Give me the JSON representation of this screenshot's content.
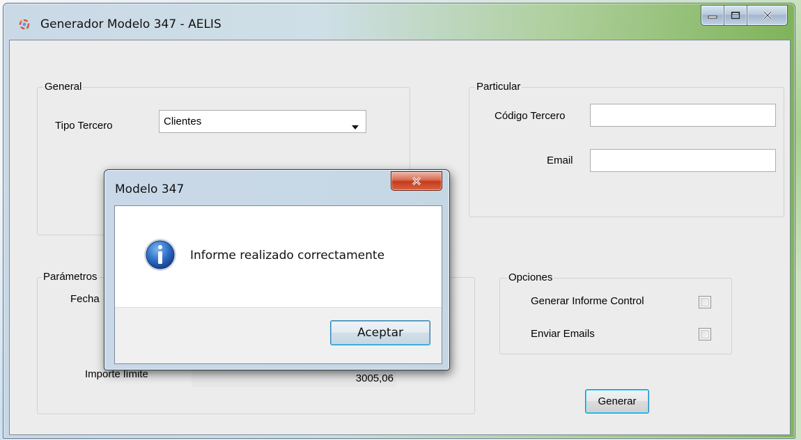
{
  "window": {
    "title": "Generador Modelo 347 - AELIS"
  },
  "general": {
    "legend": "General",
    "tipo_tercero_label": "Tipo Tercero",
    "tipo_tercero_value": "Clientes"
  },
  "particular": {
    "legend": "Particular",
    "codigo_tercero_label": "Código Tercero",
    "codigo_tercero_value": "",
    "email_label": "Email",
    "email_value": ""
  },
  "parametros": {
    "legend": "Parámetros",
    "fecha_label": "Fecha",
    "importe_limite_label": "Importe límite",
    "importe_limite_value": "3005,06"
  },
  "opciones": {
    "legend": "Opciones",
    "generar_informe_control_label": "Generar Informe Control",
    "generar_informe_control_checked": false,
    "enviar_emails_label": "Enviar Emails",
    "enviar_emails_checked": false
  },
  "actions": {
    "generar_label": "Generar"
  },
  "dialog": {
    "title": "Modelo 347",
    "message": "Informe realizado correctamente",
    "icon": "info-icon",
    "ok_label": "Aceptar"
  }
}
